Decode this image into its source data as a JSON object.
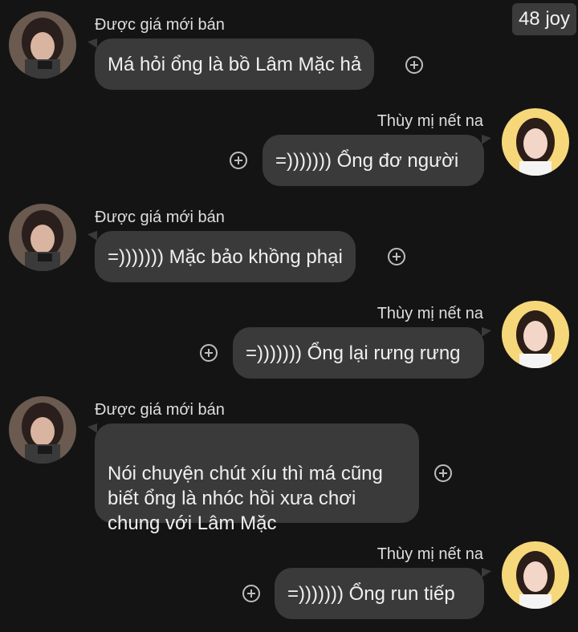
{
  "badge": "48 joy",
  "messages": [
    {
      "sender": "Được giá mới bán",
      "text": "Má hỏi ổng là bồ Lâm Mặc hả"
    },
    {
      "sender": "Thùy mị nết na",
      "text": "=))))))) Ổng đơ người"
    },
    {
      "sender": "Được giá mới bán",
      "text": "=))))))) Mặc bảo khồng phại"
    },
    {
      "sender": "Thùy mị nết na",
      "text": "=))))))) Ổng lại rưng rưng"
    },
    {
      "sender": "Được giá mới bán",
      "text": "Nói chuyện chút xíu thì má cũng\nbiết ổng là nhóc hồi xưa chơi\nchung với Lâm Mặc"
    },
    {
      "sender": "Thùy mị nết na",
      "text": "=))))))) Ổng run tiếp"
    }
  ],
  "icons": {
    "add": "plus-circle-icon",
    "avatar_left": "avatar-dark-hair",
    "avatar_right": "avatar-yellow-bg"
  },
  "colors": {
    "background": "#141414",
    "bubble": "#3a3a3a",
    "text": "#f0f0f0",
    "badge_bg": "#3b3b3b",
    "avatar_right_bg": "#f6d87a"
  }
}
